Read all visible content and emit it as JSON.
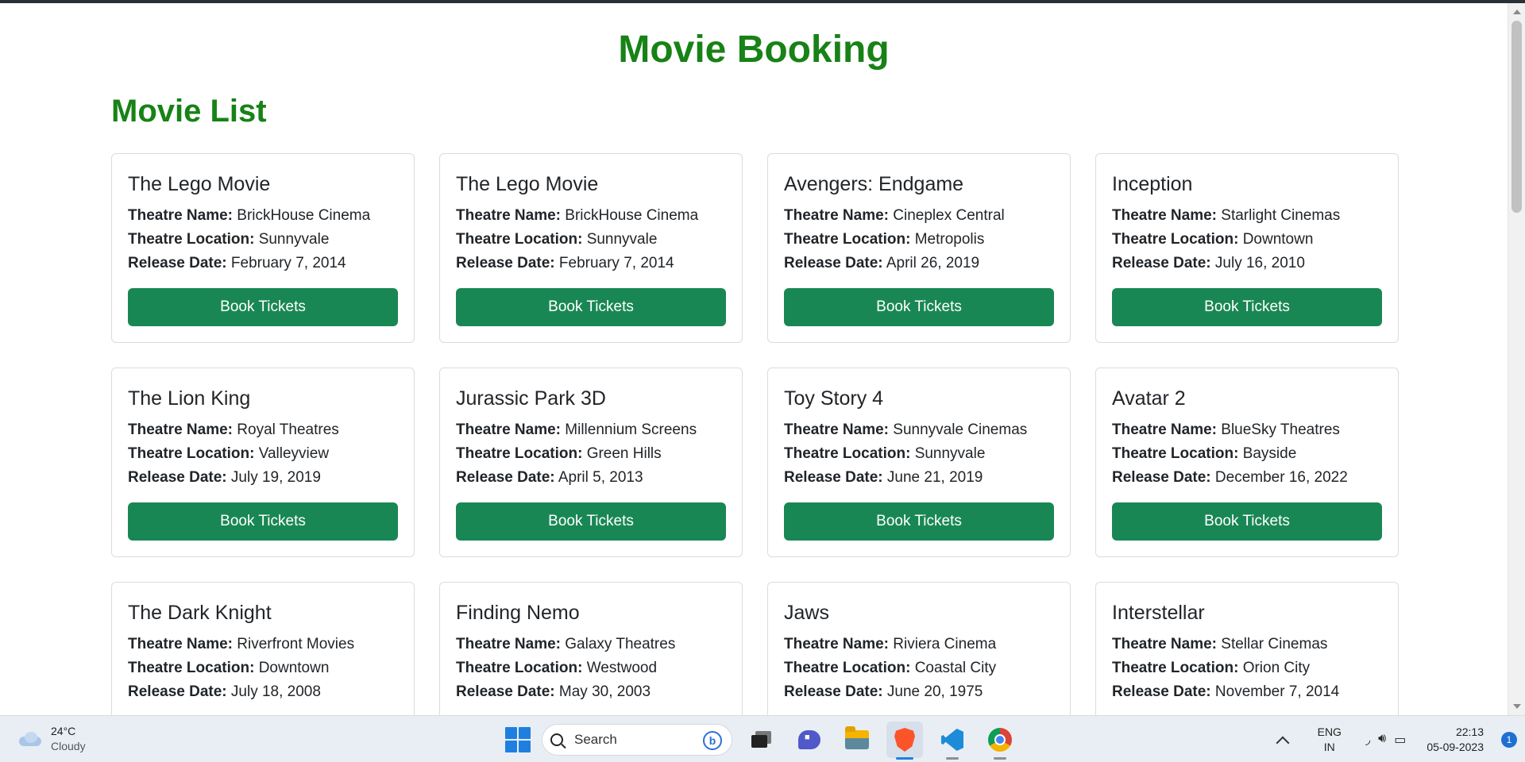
{
  "page": {
    "title": "Movie Booking",
    "section_title": "Movie List"
  },
  "labels": {
    "theatre_name": "Theatre Name:",
    "theatre_location": "Theatre Location:",
    "release_date": "Release Date:",
    "book_button": "Book Tickets"
  },
  "movies": [
    {
      "title": "The Lego Movie",
      "theatre_name": "BrickHouse Cinema",
      "theatre_location": "Sunnyvale",
      "release_date": "February 7, 2014"
    },
    {
      "title": "The Lego Movie",
      "theatre_name": "BrickHouse Cinema",
      "theatre_location": "Sunnyvale",
      "release_date": "February 7, 2014"
    },
    {
      "title": "Avengers: Endgame",
      "theatre_name": "Cineplex Central",
      "theatre_location": "Metropolis",
      "release_date": "April 26, 2019"
    },
    {
      "title": "Inception",
      "theatre_name": "Starlight Cinemas",
      "theatre_location": "Downtown",
      "release_date": "July 16, 2010"
    },
    {
      "title": "The Lion King",
      "theatre_name": "Royal Theatres",
      "theatre_location": "Valleyview",
      "release_date": "July 19, 2019"
    },
    {
      "title": "Jurassic Park 3D",
      "theatre_name": "Millennium Screens",
      "theatre_location": "Green Hills",
      "release_date": "April 5, 2013"
    },
    {
      "title": "Toy Story 4",
      "theatre_name": "Sunnyvale Cinemas",
      "theatre_location": "Sunnyvale",
      "release_date": "June 21, 2019"
    },
    {
      "title": "Avatar 2",
      "theatre_name": "BlueSky Theatres",
      "theatre_location": "Bayside",
      "release_date": "December 16, 2022"
    },
    {
      "title": "The Dark Knight",
      "theatre_name": "Riverfront Movies",
      "theatre_location": "Downtown",
      "release_date": "July 18, 2008"
    },
    {
      "title": "Finding Nemo",
      "theatre_name": "Galaxy Theatres",
      "theatre_location": "Westwood",
      "release_date": "May 30, 2003"
    },
    {
      "title": "Jaws",
      "theatre_name": "Riviera Cinema",
      "theatre_location": "Coastal City",
      "release_date": "June 20, 1975"
    },
    {
      "title": "Interstellar",
      "theatre_name": "Stellar Cinemas",
      "theatre_location": "Orion City",
      "release_date": "November 7, 2014"
    }
  ],
  "colors": {
    "heading": "#178216",
    "button": "#198754"
  },
  "taskbar": {
    "weather": {
      "temp": "24°C",
      "condition": "Cloudy",
      "icon": "cloud-icon"
    },
    "search_label": "Search",
    "bing_glyph": "b",
    "apps": [
      {
        "name": "task-view-icon"
      },
      {
        "name": "chat-icon"
      },
      {
        "name": "file-explorer-icon"
      },
      {
        "name": "brave-browser-icon"
      },
      {
        "name": "vscode-icon"
      },
      {
        "name": "chrome-icon"
      }
    ],
    "language": {
      "line1": "ENG",
      "line2": "IN"
    },
    "clock": {
      "time": "22:13",
      "date": "05-09-2023"
    },
    "notification_count": "1"
  }
}
